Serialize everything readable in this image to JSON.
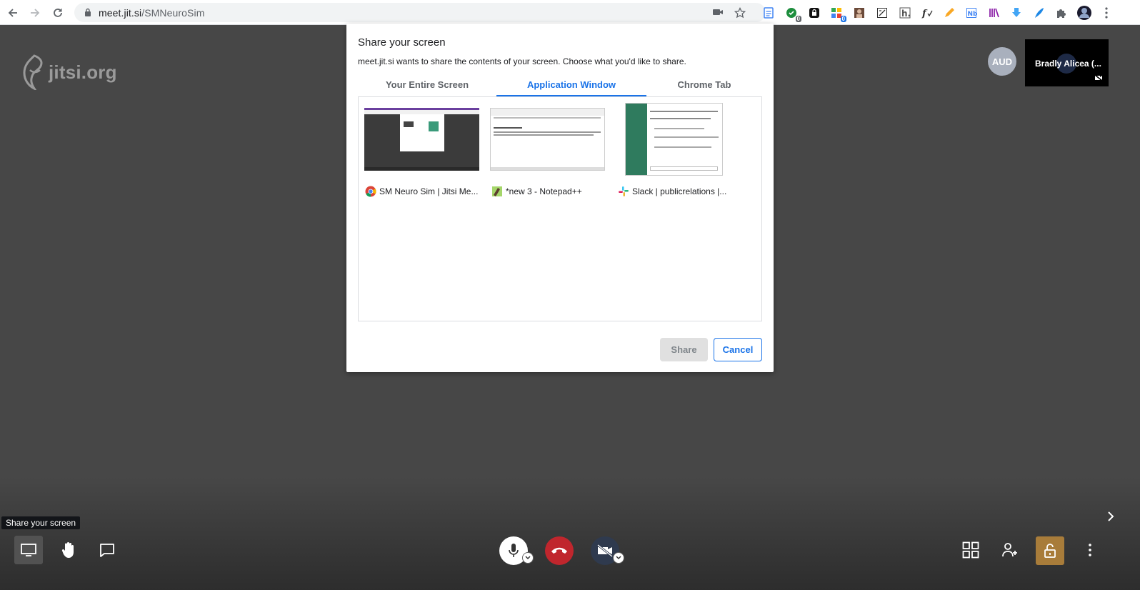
{
  "browser": {
    "url_host": "meet.jit.si",
    "url_path": "/SMNeuroSim",
    "ext_badges": [
      "0",
      "0"
    ]
  },
  "meeting": {
    "logo_text": "jitsi.org",
    "avatar_initials": "AUD",
    "participant_name": "Bradly Alicea (..."
  },
  "dialog": {
    "title": "Share your screen",
    "subtitle": "meet.jit.si wants to share the contents of your screen. Choose what you'd like to share.",
    "tabs": [
      {
        "label": "Your Entire Screen",
        "active": false
      },
      {
        "label": "Application Window",
        "active": true
      },
      {
        "label": "Chrome Tab",
        "active": false
      }
    ],
    "sources": [
      {
        "label": "SM Neuro Sim | Jitsi Me...",
        "icon": "chrome-icon"
      },
      {
        "label": "*new 3 - Notepad++",
        "icon": "notepadpp-icon"
      },
      {
        "label": "Slack | publicrelations |...",
        "icon": "slack-icon"
      }
    ],
    "share_label": "Share",
    "cancel_label": "Cancel"
  },
  "toolbar": {
    "tooltip": "Share your screen"
  },
  "colors": {
    "accent": "#1a73e8",
    "hangup": "#c0262d",
    "security": "#a87c3a",
    "background": "#474747"
  }
}
